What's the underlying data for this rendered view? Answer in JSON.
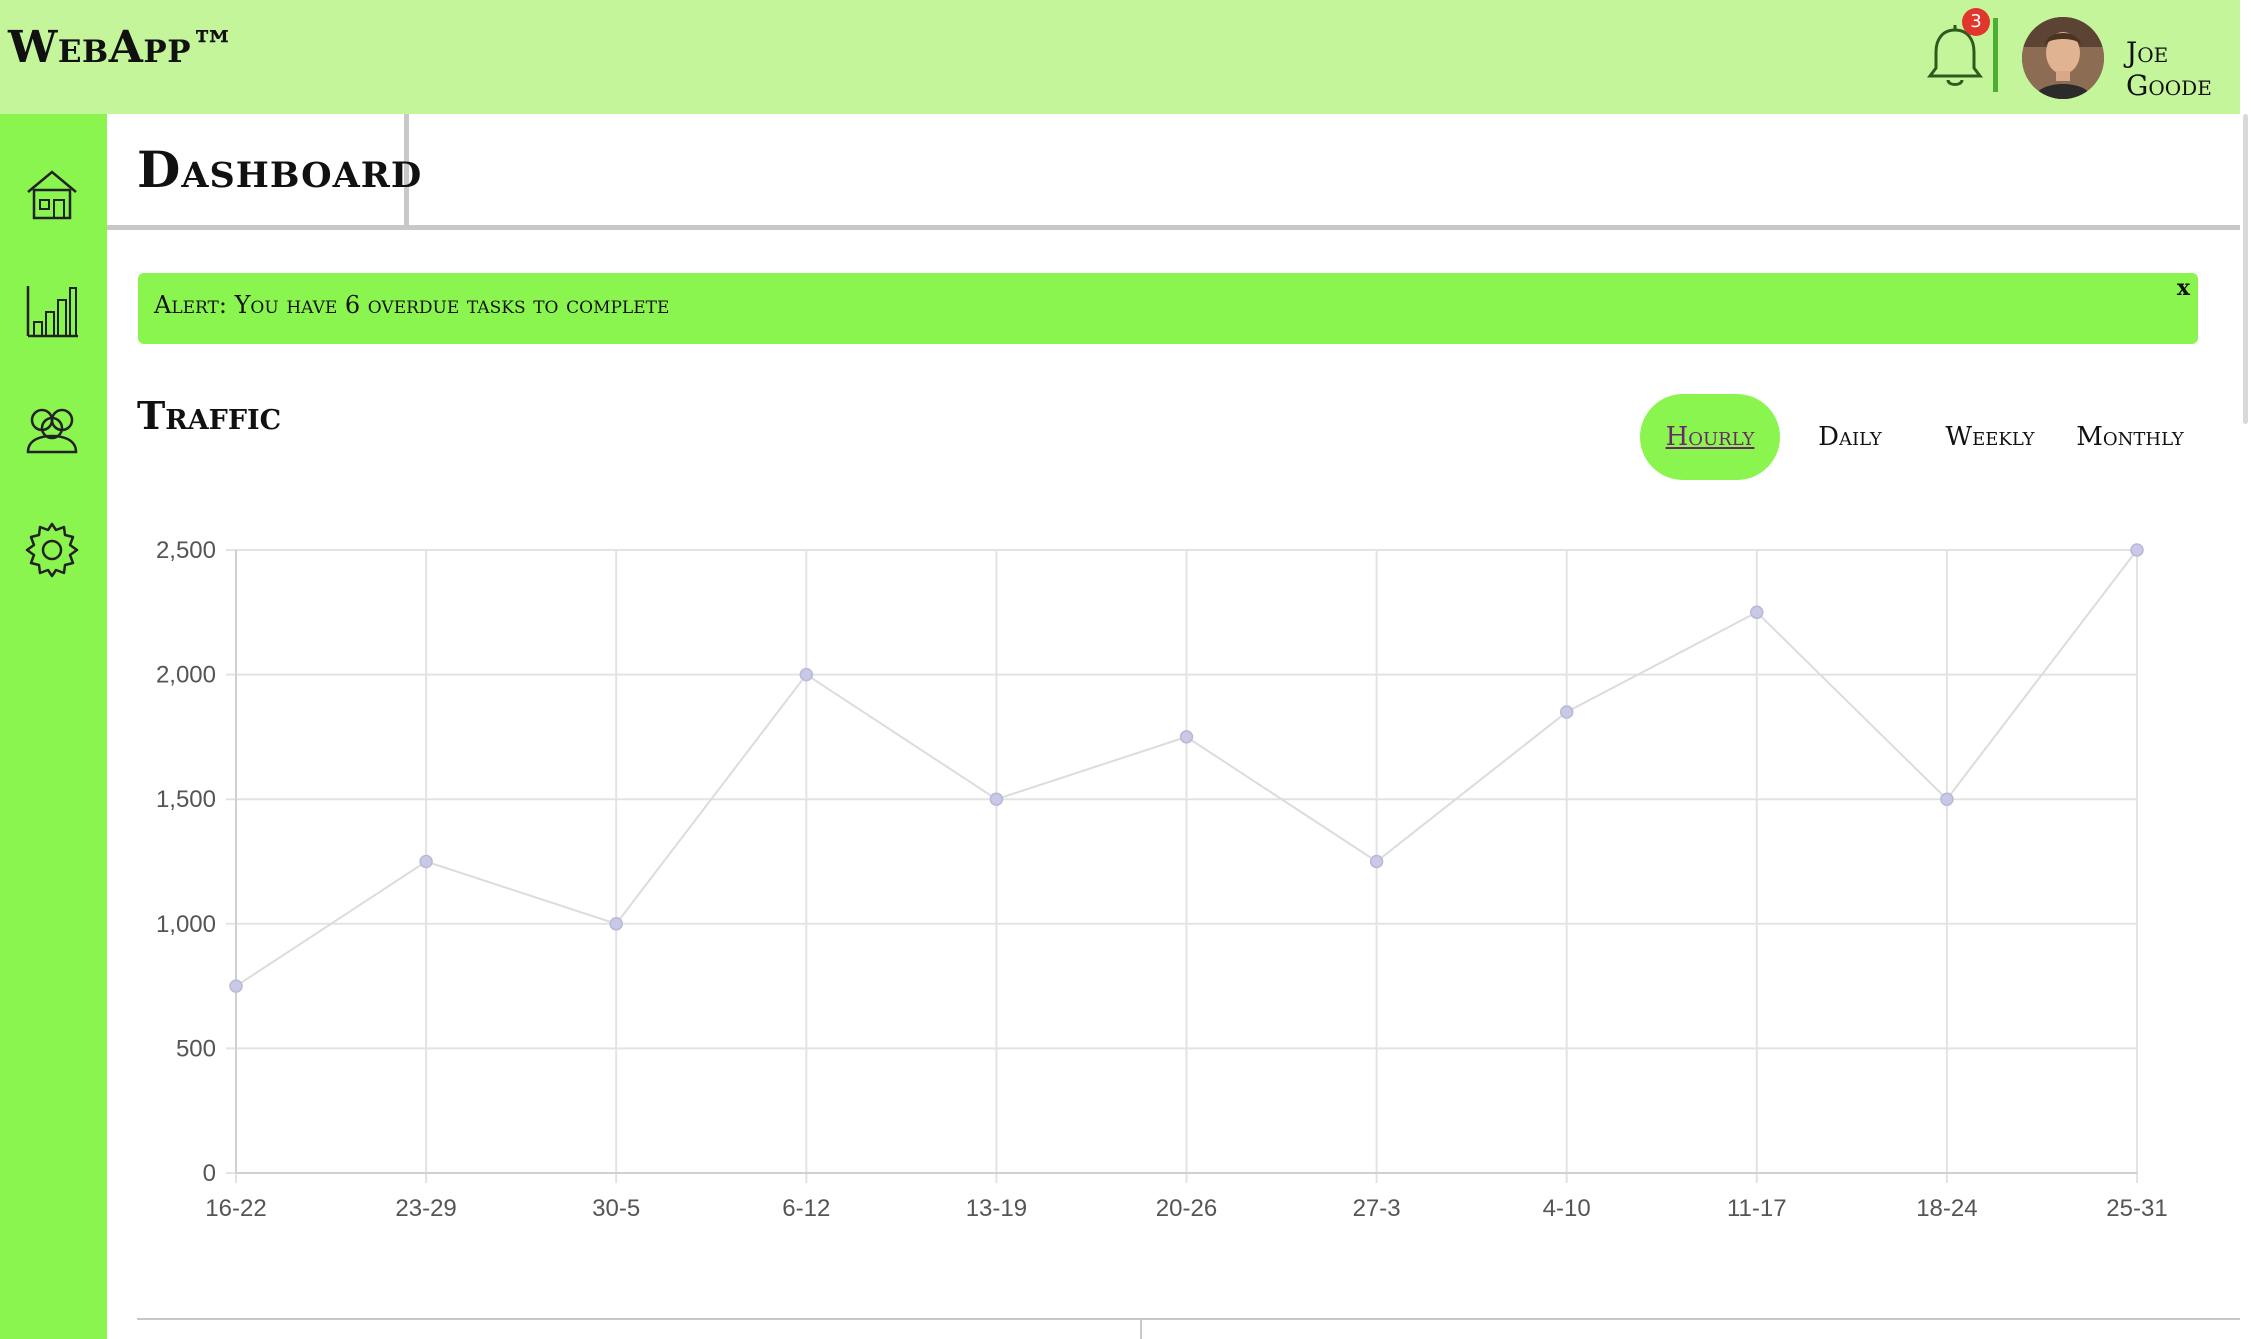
{
  "app": {
    "brand": "WebApp™"
  },
  "header": {
    "notification_count": "3",
    "user_name": "Joe Goode",
    "icons": {
      "notifications": "bell-icon",
      "avatar": "user-avatar"
    }
  },
  "sidebar": {
    "items": [
      {
        "name": "home",
        "icon": "house-icon"
      },
      {
        "name": "analytics",
        "icon": "bar-chart-icon"
      },
      {
        "name": "members",
        "icon": "users-icon"
      },
      {
        "name": "settings",
        "icon": "gear-icon"
      }
    ]
  },
  "page": {
    "title": "Dashboard"
  },
  "alert": {
    "text": "Alert: You have 6 overdue tasks to complete",
    "close_label": "x"
  },
  "traffic": {
    "title": "Traffic",
    "tabs": [
      {
        "label": "Hourly",
        "active": true
      },
      {
        "label": "Daily",
        "active": false
      },
      {
        "label": "Weekly",
        "active": false
      },
      {
        "label": "Monthly",
        "active": false
      }
    ]
  },
  "colors": {
    "header_bg": "#c4f59b",
    "accent_green": "#8bf54f",
    "divider_green": "#4caf34",
    "badge_red": "#e0362b",
    "chart_line": "#dcdcdc",
    "chart_point": "#c9c9e6"
  },
  "chart_data": {
    "type": "line",
    "title": "",
    "xlabel": "",
    "ylabel": "",
    "categories": [
      "16-22",
      "23-29",
      "30-5",
      "6-12",
      "13-19",
      "20-26",
      "27-3",
      "4-10",
      "11-17",
      "18-24",
      "25-31"
    ],
    "series": [
      {
        "values": [
          750,
          1250,
          1000,
          2000,
          1500,
          1750,
          1250,
          1850,
          2250,
          1500,
          2500
        ]
      }
    ],
    "ylim": [
      0,
      2500
    ],
    "yticks": [
      0,
      500,
      1000,
      1500,
      2000,
      2500
    ],
    "ytick_labels": [
      "0",
      "500",
      "1,000",
      "1,500",
      "2,000",
      "2,500"
    ],
    "grid": true,
    "legend": "none"
  }
}
